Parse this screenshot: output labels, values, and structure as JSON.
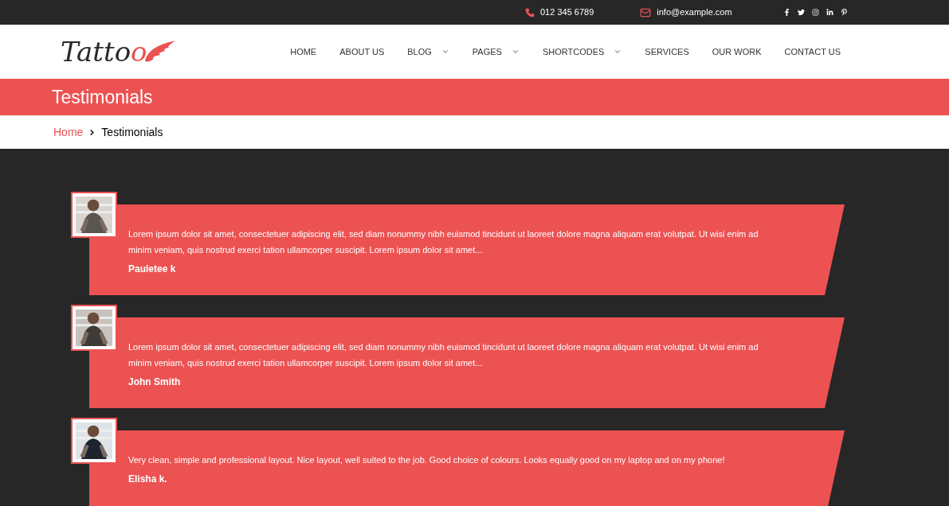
{
  "top_bar": {
    "phone": "012 345 6789",
    "email": "info@example.com"
  },
  "logo": {
    "text": "Tatto",
    "accent": "o"
  },
  "nav": [
    {
      "label": "HOME",
      "has_menu": false
    },
    {
      "label": "ABOUT US",
      "has_menu": false
    },
    {
      "label": "BLOG",
      "has_menu": true
    },
    {
      "label": "PAGES",
      "has_menu": true
    },
    {
      "label": "SHORTCODES",
      "has_menu": true
    },
    {
      "label": "SERVICES",
      "has_menu": false
    },
    {
      "label": "OUR WORK",
      "has_menu": false
    },
    {
      "label": "CONTACT US",
      "has_menu": false
    }
  ],
  "page_title": "Testimonials",
  "breadcrumb": [
    {
      "label": "Home",
      "kind": "link"
    },
    {
      "label": "Testimonials",
      "kind": "current"
    }
  ],
  "testimonials": [
    {
      "quote": "Lorem ipsum dolor sit amet, consectetuer adipiscing elit, sed diam nonummy nibh euismod tincidunt ut laoreet dolore magna aliquam erat volutpat. Ut wisi enim ad minim veniam, quis nostrud exerci tation ullamcorper suscipit. Lorem ipsum dolor sit amet...",
      "name": "Pauletee k"
    },
    {
      "quote": "Lorem ipsum dolor sit amet, consectetuer adipiscing elit, sed diam nonummy nibh euismod tincidunt ut laoreet dolore magna aliquam erat volutpat. Ut wisi enim ad minim veniam, quis nostrud exerci tation ullamcorper suscipit. Lorem ipsum dolor sit amet...",
      "name": "John Smith"
    },
    {
      "quote": "Very clean, simple and professional layout. Nice layout, well suited to the job. Good choice of colours. Looks equally good on my laptop and on my phone!",
      "name": "Elisha k."
    }
  ]
}
